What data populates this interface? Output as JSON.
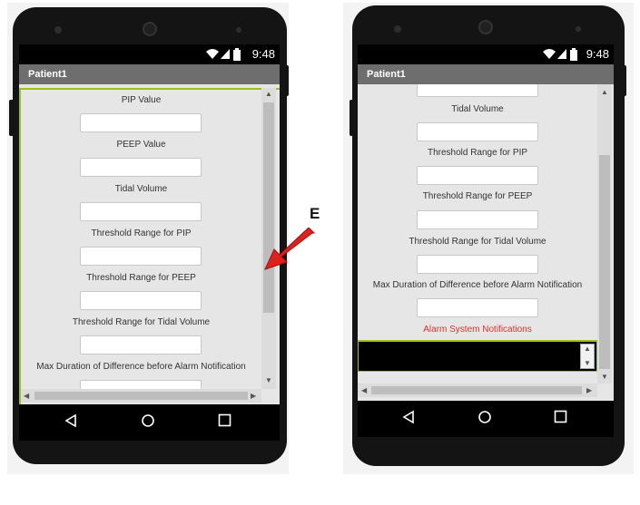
{
  "status_bar": {
    "time": "9:48"
  },
  "app": {
    "title": "Patient1"
  },
  "form_fields": [
    {
      "label": "PIP Value"
    },
    {
      "label": "PEEP Value"
    },
    {
      "label": "Tidal Volume"
    },
    {
      "label": "Threshold Range for PIP"
    },
    {
      "label": "Threshold Range for PEEP"
    },
    {
      "label": "Threshold Range for Tidal Volume"
    },
    {
      "label": "Max Duration of Difference before Alarm Notification"
    }
  ],
  "alarm": {
    "label": "Alarm System Notifications",
    "color": "#e0312b"
  },
  "annotation": {
    "label": "E",
    "arrow_color": "#e0201c"
  },
  "colors": {
    "accent_green": "#9cc21b",
    "title_bar": "#6e6e6e"
  }
}
